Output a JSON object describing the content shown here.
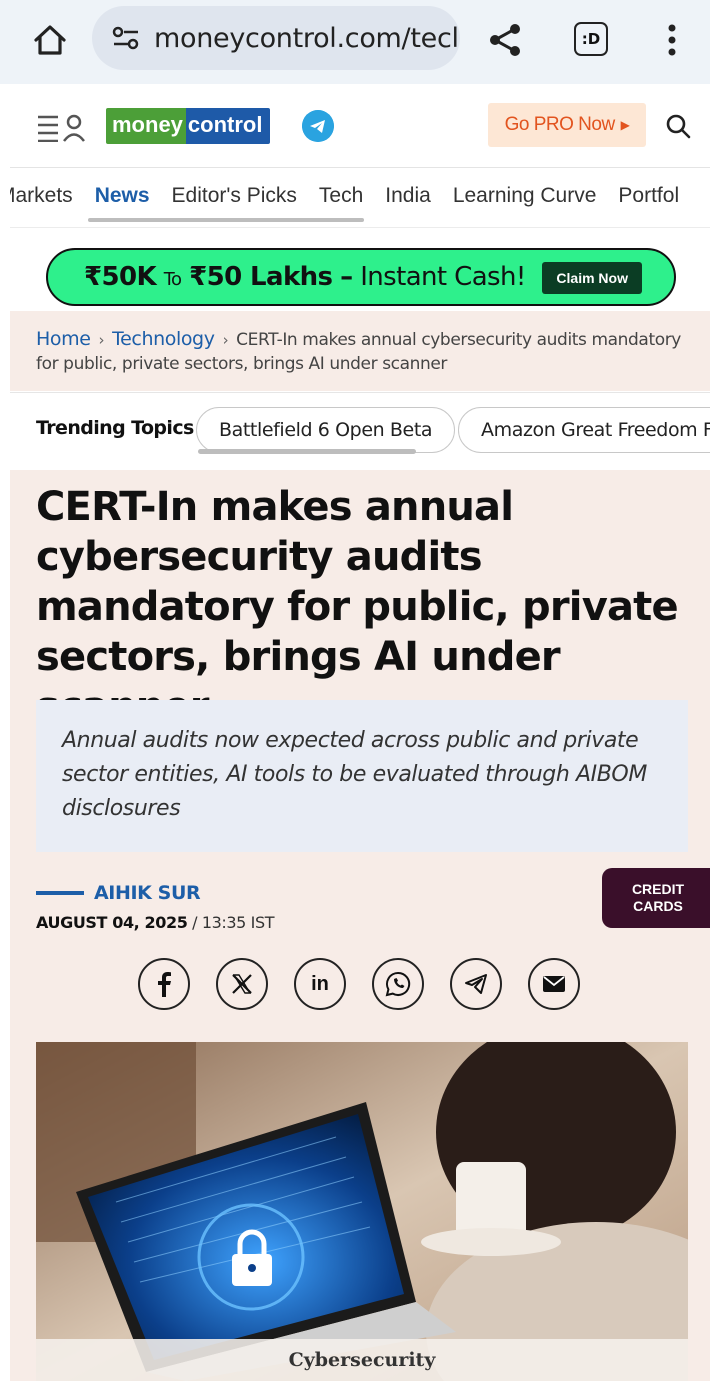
{
  "browser": {
    "url": "moneycontrol.com/tecl",
    "tabs_icon_label": ":D"
  },
  "header": {
    "logo_part1": "money",
    "logo_part2": "control",
    "pro_button": "Go PRO Now"
  },
  "nav": {
    "items": [
      "Markets",
      "News",
      "Editor's Picks",
      "Tech",
      "India",
      "Learning Curve",
      "Portfol"
    ]
  },
  "promo": {
    "amount_from": "₹50K",
    "to": "To",
    "amount_to": "₹50 Lakhs",
    "dash": "–",
    "tail": "Instant Cash!",
    "cta": "Claim Now"
  },
  "breadcrumb": {
    "home": "Home",
    "section": "Technology",
    "current": "CERT-In makes annual cybersecurity audits mandatory for public, private sectors, brings AI under scanner"
  },
  "trending": {
    "label": "Trending Topics",
    "topics": [
      "Battlefield 6 Open Beta",
      "Amazon Great Freedom Fe"
    ]
  },
  "article": {
    "title": "CERT-In makes annual cybersecurity audits mandatory for public, private sectors, brings AI under scanner",
    "summary": "Annual audits now expected across public and private sector entities, AI tools to be evaluated through AIBOM disclosures",
    "author": "AIHIK SUR",
    "date": "AUGUST 04, 2025",
    "time": " / 13:35 IST",
    "credit_badge_line1": "CREDIT",
    "credit_badge_line2": "CARDS",
    "image_caption": "Cybersecurity"
  },
  "social": [
    "facebook-icon",
    "x-icon",
    "linkedin-icon",
    "whatsapp-icon",
    "telegram-icon",
    "email-icon"
  ],
  "colors": {
    "brand_blue": "#1d5ea8",
    "brand_green": "#4c9f38",
    "promo_green": "#2ef08c",
    "pro_orange": "#e2541f",
    "article_bg": "#f7ece7"
  }
}
